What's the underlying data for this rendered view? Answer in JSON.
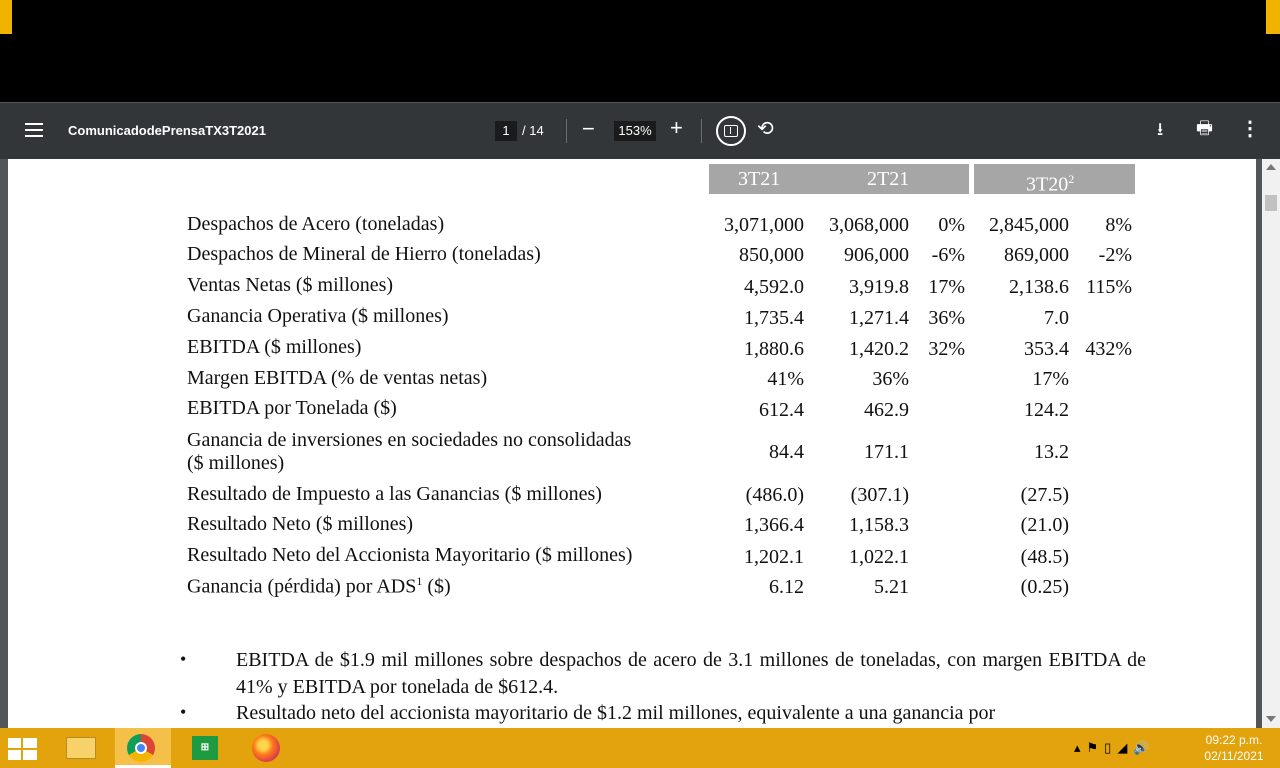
{
  "toolbar": {
    "title": "ComunicadodePrensaTX3T2021",
    "current_page": "1",
    "total_pages": "/ 14",
    "zoom": "153%",
    "minus_label": "−",
    "plus_label": "+"
  },
  "table": {
    "headers": [
      "3T21",
      "2T21",
      "3T20"
    ],
    "header_superscript": "2",
    "rows": [
      {
        "label": "Despachos de Acero (toneladas)",
        "v1": "3,071,000",
        "v2": "3,068,000",
        "c1": "0%",
        "v3": "2,845,000",
        "c2": "8%"
      },
      {
        "label": "Despachos de Mineral de Hierro (toneladas)",
        "v1": "850,000",
        "v2": "906,000",
        "c1": "-6%",
        "v3": "869,000",
        "c2": "-2%"
      },
      {
        "label": "Ventas Netas ($ millones)",
        "v1": "4,592.0",
        "v2": "3,919.8",
        "c1": "17%",
        "v3": "2,138.6",
        "c2": "115%"
      },
      {
        "label": "Ganancia Operativa ($ millones)",
        "v1": "1,735.4",
        "v2": "1,271.4",
        "c1": "36%",
        "v3": "7.0",
        "c2": ""
      },
      {
        "label": "EBITDA ($ millones)",
        "v1": "1,880.6",
        "v2": "1,420.2",
        "c1": "32%",
        "v3": "353.4",
        "c2": "432%"
      },
      {
        "label": "Margen EBITDA (% de ventas netas)",
        "v1": "41%",
        "v2": "36%",
        "c1": "",
        "v3": "17%",
        "c2": ""
      },
      {
        "label": "EBITDA por Tonelada ($)",
        "v1": "612.4",
        "v2": "462.9",
        "c1": "",
        "v3": "124.2",
        "c2": ""
      },
      {
        "label": "Ganancia de inversiones en sociedades no consolidadas",
        "label2": "($ millones)",
        "v1": "84.4",
        "v2": "171.1",
        "c1": "",
        "v3": "13.2",
        "c2": ""
      },
      {
        "label": "Resultado de Impuesto a las Ganancias ($ millones)",
        "v1": "(486.0)",
        "v2": "(307.1)",
        "c1": "",
        "v3": "(27.5)",
        "c2": ""
      },
      {
        "label": "Resultado Neto ($ millones)",
        "v1": "1,366.4",
        "v2": "1,158.3",
        "c1": "",
        "v3": "(21.0)",
        "c2": ""
      },
      {
        "label": "Resultado Neto del Accionista Mayoritario ($ millones)",
        "v1": "1,202.1",
        "v2": "1,022.1",
        "c1": "",
        "v3": "(48.5)",
        "c2": ""
      },
      {
        "label": "Ganancia (pérdida) por ADS",
        "label_sup": "1",
        "label_after": " ($)",
        "v1": "6.12",
        "v2": "5.21",
        "c1": "",
        "v3": "(0.25)",
        "c2": ""
      }
    ]
  },
  "bullets": [
    "EBITDA de $1.9 mil millones sobre despachos de acero de 3.1 millones de toneladas, con margen EBITDA de 41% y EBITDA por tonelada de $612.4.",
    "Resultado neto del accionista mayoritario de $1.2 mil millones, equivalente a una ganancia por"
  ],
  "bullet_symbol": "•",
  "taskbar": {
    "time": "09:22 p.m.",
    "date": "02/11/2021",
    "accent_color": "#e3a30c"
  }
}
